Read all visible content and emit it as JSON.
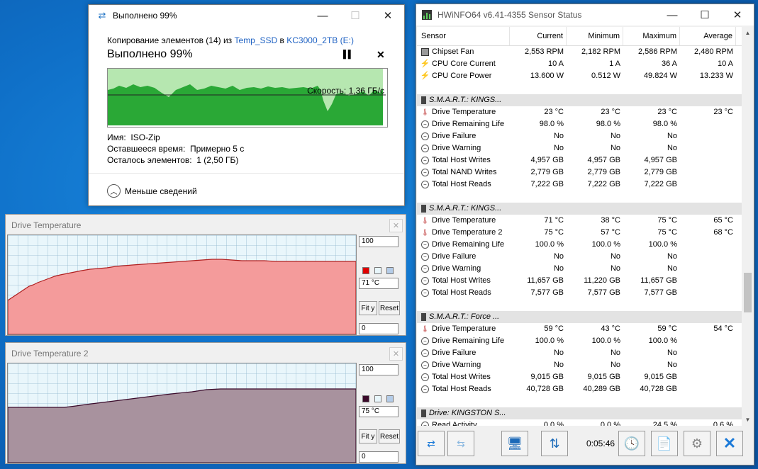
{
  "copy_dialog": {
    "title": "Выполнено 99%",
    "line_prefix": "Копирование элементов (14) из ",
    "source": "Temp_SSD",
    "in_word": " в ",
    "destination": "KC3000_2TB (E:)",
    "progress_text": "Выполнено 99%",
    "progress": 0.99,
    "speed": "Скорость: 1,36 ГБ/с",
    "name_label": "Имя:",
    "name_value": "ISO-Zip",
    "time_label": "Оставшееся время:",
    "time_value": "Примерно 5 с",
    "items_label": "Осталось элементов:",
    "items_value": "1 (2,50 ГБ)",
    "less_details": "Меньше сведений"
  },
  "graph1": {
    "title": "Drive Temperature",
    "max": "100",
    "current": "71 °C",
    "min": "0",
    "fit": "Fit y",
    "reset": "Reset",
    "color": "#ff0000"
  },
  "graph2": {
    "title": "Drive Temperature 2",
    "max": "100",
    "current": "75 °C",
    "min": "0",
    "fit": "Fit y",
    "reset": "Reset",
    "color": "#3a0a2a"
  },
  "hwinfo": {
    "title": "HWiNFO64 v6.41-4355 Sensor Status",
    "columns": [
      "Sensor",
      "Current",
      "Minimum",
      "Maximum",
      "Average"
    ],
    "rows": [
      {
        "icon": "fan",
        "name": "Chipset Fan",
        "cur": "2,553 RPM",
        "min": "2,182 RPM",
        "max": "2,586 RPM",
        "avg": "2,480 RPM"
      },
      {
        "icon": "bolt",
        "name": "CPU Core Current",
        "cur": "10 A",
        "min": "1 A",
        "max": "36 A",
        "avg": "10 A"
      },
      {
        "icon": "bolt",
        "name": "CPU Core Power",
        "cur": "13.600 W",
        "min": "0.512 W",
        "max": "49.824 W",
        "avg": "13.233 W"
      },
      {
        "gap": true
      },
      {
        "group": true,
        "name": "S.M.A.R.T.: KINGS..."
      },
      {
        "icon": "th",
        "name": "Drive Temperature",
        "cur": "23 °C",
        "min": "23 °C",
        "max": "23 °C",
        "avg": "23 °C"
      },
      {
        "icon": "cl",
        "name": "Drive Remaining Life",
        "cur": "98.0 %",
        "min": "98.0 %",
        "max": "98.0 %",
        "avg": ""
      },
      {
        "icon": "cl",
        "name": "Drive Failure",
        "cur": "No",
        "min": "No",
        "max": "No",
        "avg": ""
      },
      {
        "icon": "cl",
        "name": "Drive Warning",
        "cur": "No",
        "min": "No",
        "max": "No",
        "avg": ""
      },
      {
        "icon": "cl",
        "name": "Total Host Writes",
        "cur": "4,957 GB",
        "min": "4,957 GB",
        "max": "4,957 GB",
        "avg": ""
      },
      {
        "icon": "cl",
        "name": "Total NAND Writes",
        "cur": "2,779 GB",
        "min": "2,779 GB",
        "max": "2,779 GB",
        "avg": ""
      },
      {
        "icon": "cl",
        "name": "Total Host Reads",
        "cur": "7,222 GB",
        "min": "7,222 GB",
        "max": "7,222 GB",
        "avg": ""
      },
      {
        "gap": true
      },
      {
        "group": true,
        "name": "S.M.A.R.T.: KINGS..."
      },
      {
        "icon": "th",
        "name": "Drive Temperature",
        "cur": "71 °C",
        "min": "38 °C",
        "max": "75 °C",
        "avg": "65 °C"
      },
      {
        "icon": "th",
        "name": "Drive Temperature 2",
        "cur": "75 °C",
        "min": "57 °C",
        "max": "75 °C",
        "avg": "68 °C"
      },
      {
        "icon": "cl",
        "name": "Drive Remaining Life",
        "cur": "100.0 %",
        "min": "100.0 %",
        "max": "100.0 %",
        "avg": ""
      },
      {
        "icon": "cl",
        "name": "Drive Failure",
        "cur": "No",
        "min": "No",
        "max": "No",
        "avg": ""
      },
      {
        "icon": "cl",
        "name": "Drive Warning",
        "cur": "No",
        "min": "No",
        "max": "No",
        "avg": ""
      },
      {
        "icon": "cl",
        "name": "Total Host Writes",
        "cur": "11,657 GB",
        "min": "11,220 GB",
        "max": "11,657 GB",
        "avg": ""
      },
      {
        "icon": "cl",
        "name": "Total Host Reads",
        "cur": "7,577 GB",
        "min": "7,577 GB",
        "max": "7,577 GB",
        "avg": ""
      },
      {
        "gap": true
      },
      {
        "group": true,
        "name": "S.M.A.R.T.: Force ..."
      },
      {
        "icon": "th",
        "name": "Drive Temperature",
        "cur": "59 °C",
        "min": "43 °C",
        "max": "59 °C",
        "avg": "54 °C"
      },
      {
        "icon": "cl",
        "name": "Drive Remaining Life",
        "cur": "100.0 %",
        "min": "100.0 %",
        "max": "100.0 %",
        "avg": ""
      },
      {
        "icon": "cl",
        "name": "Drive Failure",
        "cur": "No",
        "min": "No",
        "max": "No",
        "avg": ""
      },
      {
        "icon": "cl",
        "name": "Drive Warning",
        "cur": "No",
        "min": "No",
        "max": "No",
        "avg": ""
      },
      {
        "icon": "cl",
        "name": "Total Host Writes",
        "cur": "9,015 GB",
        "min": "9,015 GB",
        "max": "9,015 GB",
        "avg": ""
      },
      {
        "icon": "cl",
        "name": "Total Host Reads",
        "cur": "40,728 GB",
        "min": "40,289 GB",
        "max": "40,728 GB",
        "avg": ""
      },
      {
        "gap": true
      },
      {
        "group": true,
        "name": "Drive: KINGSTON S..."
      },
      {
        "icon": "cl",
        "name": "Read Activity",
        "cur": "0.0 %",
        "min": "0.0 %",
        "max": "24.5 %",
        "avg": "0.6 %"
      }
    ],
    "timer": "0:05:46"
  }
}
